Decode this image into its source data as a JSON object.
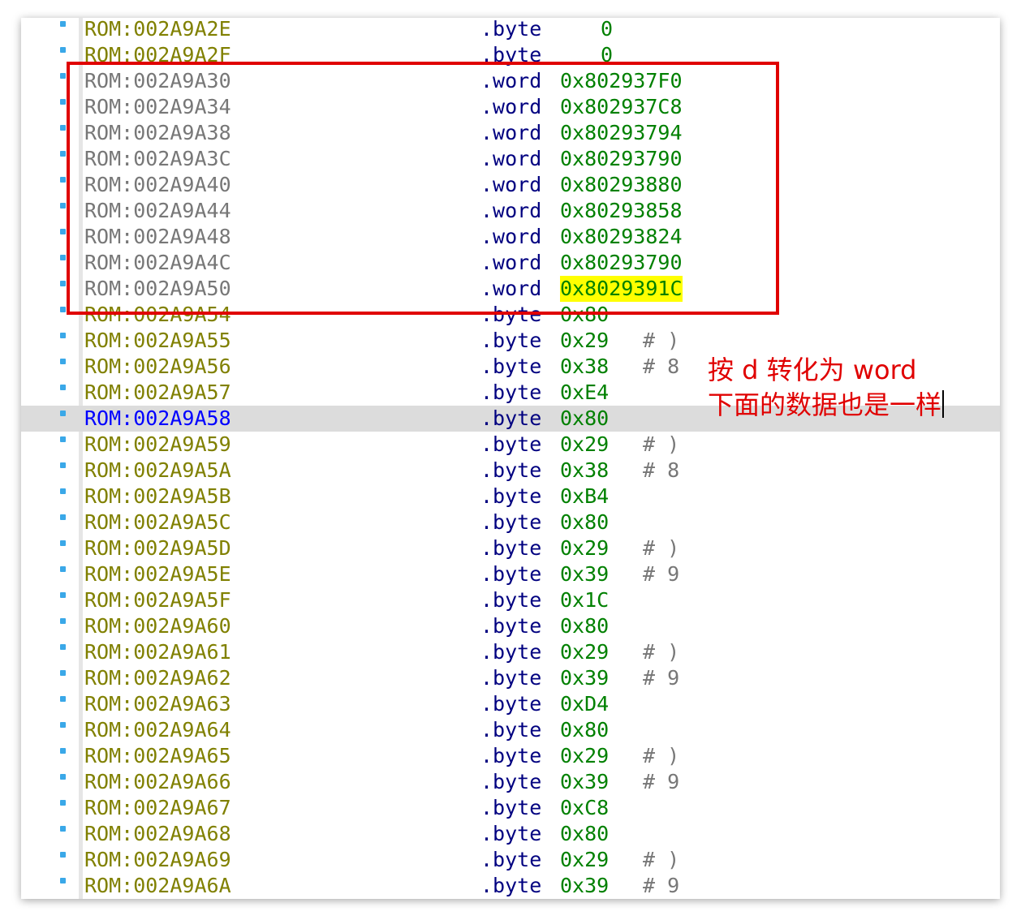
{
  "listing": {
    "rows": [
      {
        "address": "ROM:002A9A2E",
        "directive": ".byte",
        "value": "0",
        "comment": "",
        "addr_color": "olive"
      },
      {
        "address": "ROM:002A9A2F",
        "directive": ".byte",
        "value": "0",
        "comment": "",
        "addr_color": "olive"
      },
      {
        "address": "ROM:002A9A30",
        "directive": ".word",
        "value": "0x802937F0",
        "comment": "",
        "addr_color": "gray"
      },
      {
        "address": "ROM:002A9A34",
        "directive": ".word",
        "value": "0x802937C8",
        "comment": "",
        "addr_color": "gray"
      },
      {
        "address": "ROM:002A9A38",
        "directive": ".word",
        "value": "0x80293794",
        "comment": "",
        "addr_color": "gray"
      },
      {
        "address": "ROM:002A9A3C",
        "directive": ".word",
        "value": "0x80293790",
        "comment": "",
        "addr_color": "gray"
      },
      {
        "address": "ROM:002A9A40",
        "directive": ".word",
        "value": "0x80293880",
        "comment": "",
        "addr_color": "gray"
      },
      {
        "address": "ROM:002A9A44",
        "directive": ".word",
        "value": "0x80293858",
        "comment": "",
        "addr_color": "gray"
      },
      {
        "address": "ROM:002A9A48",
        "directive": ".word",
        "value": "0x80293824",
        "comment": "",
        "addr_color": "gray"
      },
      {
        "address": "ROM:002A9A4C",
        "directive": ".word",
        "value": "0x80293790",
        "comment": "",
        "addr_color": "gray"
      },
      {
        "address": "ROM:002A9A50",
        "directive": ".word",
        "value": "0x8029391C",
        "comment": "",
        "addr_color": "gray",
        "highlight": true
      },
      {
        "address": "ROM:002A9A54",
        "directive": ".byte",
        "value": "0x80",
        "comment": "",
        "addr_color": "olive"
      },
      {
        "address": "ROM:002A9A55",
        "directive": ".byte",
        "value": "0x29",
        "comment": "# )",
        "addr_color": "olive"
      },
      {
        "address": "ROM:002A9A56",
        "directive": ".byte",
        "value": "0x38",
        "comment": "# 8",
        "addr_color": "olive"
      },
      {
        "address": "ROM:002A9A57",
        "directive": ".byte",
        "value": "0xE4",
        "comment": "",
        "addr_color": "olive"
      },
      {
        "address": "ROM:002A9A58",
        "directive": ".byte",
        "value": "0x80",
        "comment": "",
        "addr_color": "blue",
        "current": true
      },
      {
        "address": "ROM:002A9A59",
        "directive": ".byte",
        "value": "0x29",
        "comment": "# )",
        "addr_color": "olive"
      },
      {
        "address": "ROM:002A9A5A",
        "directive": ".byte",
        "value": "0x38",
        "comment": "# 8",
        "addr_color": "olive"
      },
      {
        "address": "ROM:002A9A5B",
        "directive": ".byte",
        "value": "0xB4",
        "comment": "",
        "addr_color": "olive"
      },
      {
        "address": "ROM:002A9A5C",
        "directive": ".byte",
        "value": "0x80",
        "comment": "",
        "addr_color": "olive"
      },
      {
        "address": "ROM:002A9A5D",
        "directive": ".byte",
        "value": "0x29",
        "comment": "# )",
        "addr_color": "olive"
      },
      {
        "address": "ROM:002A9A5E",
        "directive": ".byte",
        "value": "0x39",
        "comment": "# 9",
        "addr_color": "olive"
      },
      {
        "address": "ROM:002A9A5F",
        "directive": ".byte",
        "value": "0x1C",
        "comment": "",
        "addr_color": "olive"
      },
      {
        "address": "ROM:002A9A60",
        "directive": ".byte",
        "value": "0x80",
        "comment": "",
        "addr_color": "olive"
      },
      {
        "address": "ROM:002A9A61",
        "directive": ".byte",
        "value": "0x29",
        "comment": "# )",
        "addr_color": "olive"
      },
      {
        "address": "ROM:002A9A62",
        "directive": ".byte",
        "value": "0x39",
        "comment": "# 9",
        "addr_color": "olive"
      },
      {
        "address": "ROM:002A9A63",
        "directive": ".byte",
        "value": "0xD4",
        "comment": "",
        "addr_color": "olive"
      },
      {
        "address": "ROM:002A9A64",
        "directive": ".byte",
        "value": "0x80",
        "comment": "",
        "addr_color": "olive"
      },
      {
        "address": "ROM:002A9A65",
        "directive": ".byte",
        "value": "0x29",
        "comment": "# )",
        "addr_color": "olive"
      },
      {
        "address": "ROM:002A9A66",
        "directive": ".byte",
        "value": "0x39",
        "comment": "# 9",
        "addr_color": "olive"
      },
      {
        "address": "ROM:002A9A67",
        "directive": ".byte",
        "value": "0xC8",
        "comment": "",
        "addr_color": "olive"
      },
      {
        "address": "ROM:002A9A68",
        "directive": ".byte",
        "value": "0x80",
        "comment": "",
        "addr_color": "olive"
      },
      {
        "address": "ROM:002A9A69",
        "directive": ".byte",
        "value": "0x29",
        "comment": "# )",
        "addr_color": "olive"
      },
      {
        "address": "ROM:002A9A6A",
        "directive": ".byte",
        "value": "0x39",
        "comment": "# 9",
        "addr_color": "olive"
      }
    ]
  },
  "annotation": {
    "line1": "按 d 转化为 word",
    "line2": "下面的数据也是一样"
  },
  "colors": {
    "address_olive": "#808000",
    "address_gray": "#777777",
    "address_current": "#0000ff",
    "directive": "#000080",
    "value": "#008000",
    "highlight": "#ffff00",
    "annotation_red": "#e00000",
    "breakpoint_marker": "#3aa8e8"
  }
}
